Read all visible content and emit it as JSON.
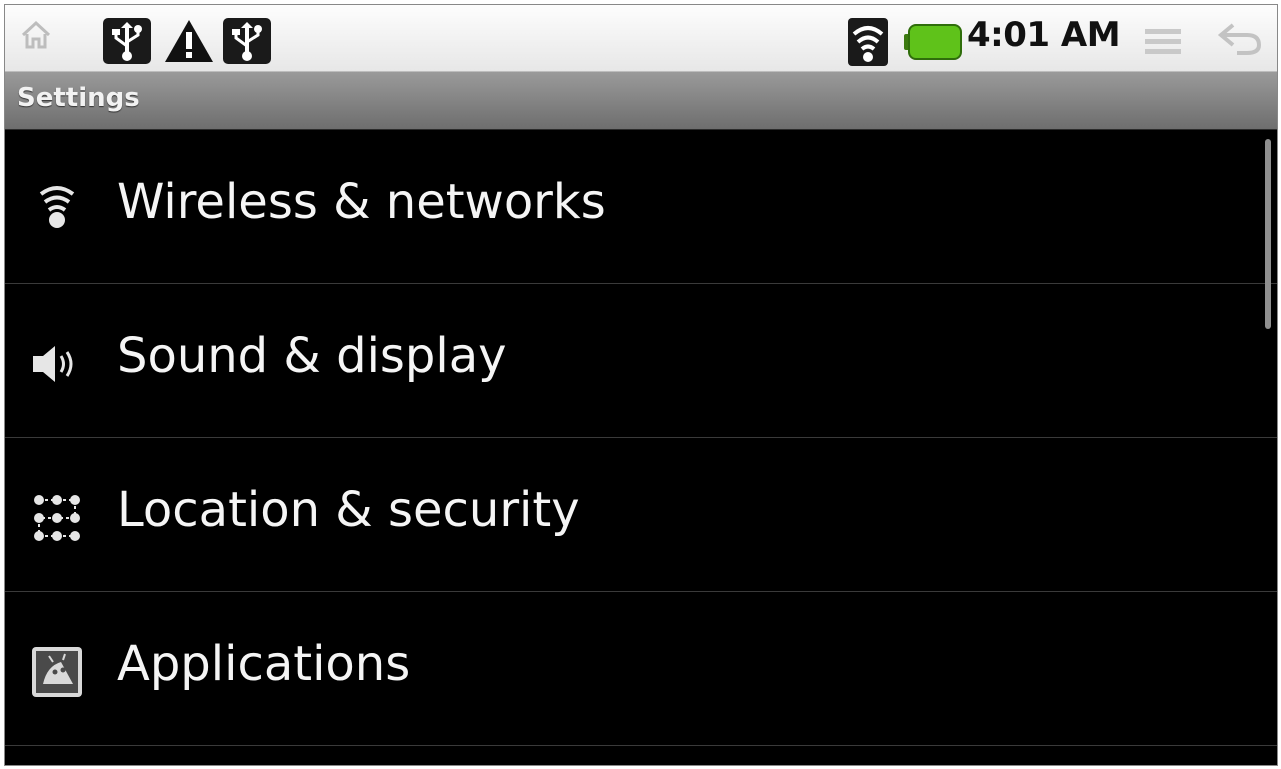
{
  "status_bar": {
    "time": "4:01 AM",
    "icons": [
      "home-icon",
      "usb-icon",
      "warning-icon",
      "usb-icon",
      "wifi-signal-icon",
      "battery-icon",
      "menu-icon",
      "back-icon"
    ],
    "battery_color": "#5fc21a"
  },
  "title_bar": {
    "title": "Settings"
  },
  "settings_list": {
    "items": [
      {
        "label": "Wireless & networks",
        "icon": "wifi-icon"
      },
      {
        "label": "Sound & display",
        "icon": "speaker-icon"
      },
      {
        "label": "Location & security",
        "icon": "location-grid-icon"
      },
      {
        "label": "Applications",
        "icon": "android-app-icon"
      }
    ]
  },
  "colors": {
    "background": "#000000",
    "text": "#f5f5f5",
    "divider": "#3a3a3a",
    "title_bar": "#7e7e7e"
  }
}
